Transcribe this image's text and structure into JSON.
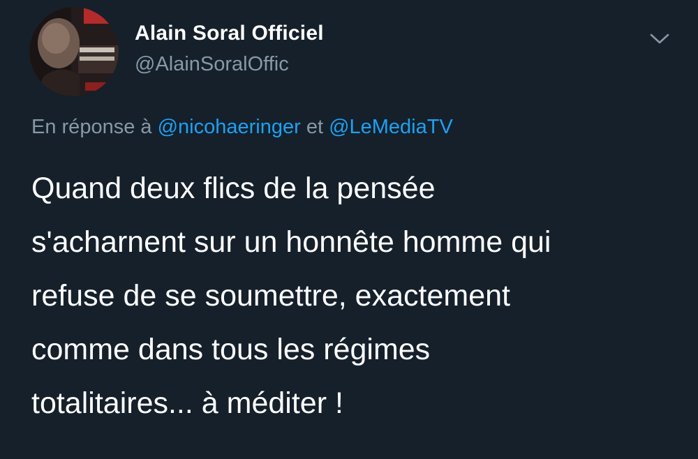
{
  "author": {
    "name": "Alain Soral Officiel",
    "handle": "@AlainSoralOffic",
    "avatar_icon": "profile-photo"
  },
  "menu": {
    "icon": "chevron-down-icon"
  },
  "reply": {
    "prefix": "En réponse à",
    "mention1": "@nicohaeringer",
    "conjunction": "et",
    "mention2": "@LeMediaTV"
  },
  "tweet": {
    "lines": [
      "Quand deux flics de la pensée",
      "s'acharnent sur un honnête homme qui",
      "refuse de se soumettre, exactement",
      "comme dans tous les régimes",
      "totalitaires... à méditer !"
    ]
  },
  "colors": {
    "background": "#15202b",
    "text": "#ffffff",
    "secondary": "#8899a6",
    "link": "#1da1f2"
  }
}
